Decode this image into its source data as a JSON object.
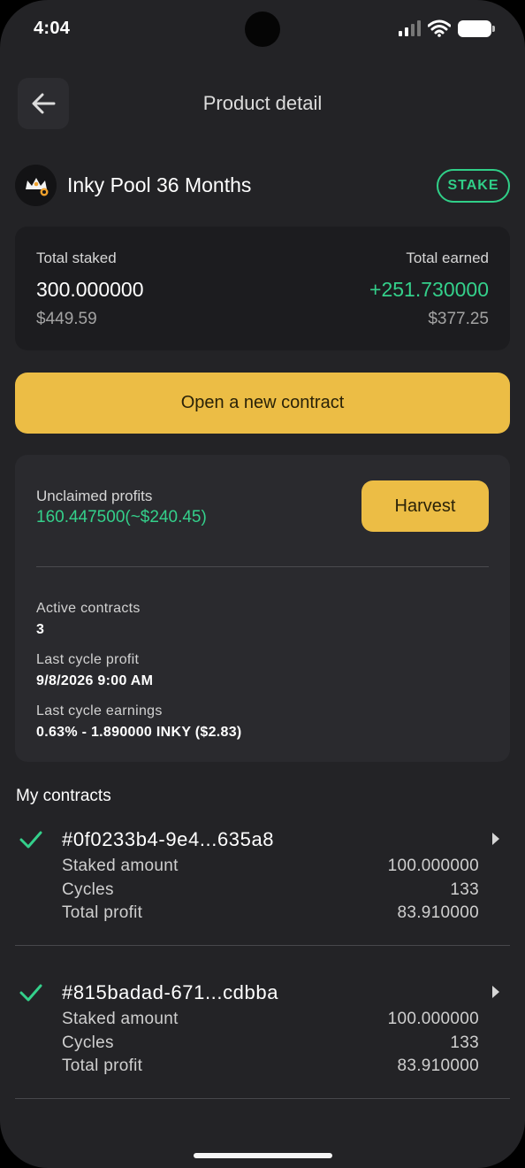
{
  "status_bar": {
    "time": "4:04"
  },
  "header": {
    "title": "Product detail"
  },
  "product": {
    "name": "Inky Pool 36 Months",
    "badge": "STAKE"
  },
  "summary": {
    "total_staked_label": "Total staked",
    "total_staked_value": "300.000000",
    "total_staked_usd": "$449.59",
    "total_earned_label": "Total earned",
    "total_earned_value": "+251.730000",
    "total_earned_usd": "$377.25"
  },
  "actions": {
    "open_contract": "Open a new contract",
    "harvest": "Harvest"
  },
  "profits": {
    "unclaimed_label": "Unclaimed profits",
    "unclaimed_value": "160.447500(~$240.45)",
    "active_contracts_label": "Active contracts",
    "active_contracts_value": "3",
    "last_cycle_profit_label": "Last cycle profit",
    "last_cycle_profit_value": "9/8/2026 9:00 AM",
    "last_cycle_earnings_label": "Last cycle earnings",
    "last_cycle_earnings_value": "0.63% - 1.890000 INKY ($2.83)"
  },
  "contracts": {
    "title": "My contracts",
    "items": [
      {
        "id": "#0f0233b4-9e4...635a8",
        "staked_label": "Staked amount",
        "staked_value": "100.000000",
        "cycles_label": "Cycles",
        "cycles_value": "133",
        "profit_label": "Total profit",
        "profit_value": "83.910000"
      },
      {
        "id": "#815badad-671...cdbba",
        "staked_label": "Staked amount",
        "staked_value": "100.000000",
        "cycles_label": "Cycles",
        "cycles_value": "133",
        "profit_label": "Total profit",
        "profit_value": "83.910000"
      }
    ]
  },
  "colors": {
    "accent": "#ecbd45",
    "positive": "#34d08b",
    "background": "#232326"
  },
  "icons": [
    "back-arrow-icon",
    "inky-logo-icon",
    "check-icon",
    "chevron-right-icon",
    "signal-icon",
    "wifi-icon",
    "battery-icon"
  ]
}
